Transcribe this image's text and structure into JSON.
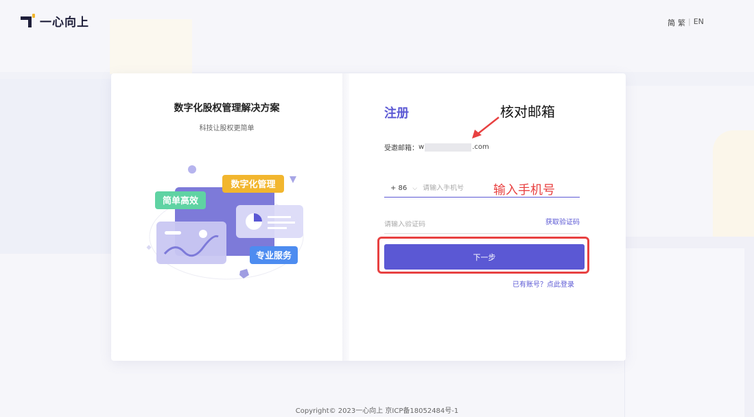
{
  "header": {
    "logo_text": "一心向上",
    "lang": {
      "simplified": "简",
      "traditional": "繁",
      "english": "EN"
    }
  },
  "left_panel": {
    "title": "数字化股权管理解决方案",
    "subtitle": "科技让股权更简单",
    "tags": {
      "tag1": "简单高效",
      "tag2": "数字化管理",
      "tag3": "专业服务"
    }
  },
  "form": {
    "title": "注册",
    "invite_label": "受邀邮箱：",
    "invite_prefix": "w",
    "invite_suffix": ".com",
    "country_code": "+ 86",
    "phone_placeholder": "请输入手机号",
    "code_placeholder": "请输入验证码",
    "get_code": "获取验证码",
    "next_button": "下一步",
    "login_link": "已有账号？点此登录"
  },
  "annotations": {
    "verify_email": "核对邮箱",
    "enter_phone": "输入手机号"
  },
  "colors": {
    "accent": "#5b58d4",
    "annotation": "#e84141"
  },
  "footer": {
    "copyright": "Copyright© 2023一心向上 京ICP备18052484号-1"
  }
}
